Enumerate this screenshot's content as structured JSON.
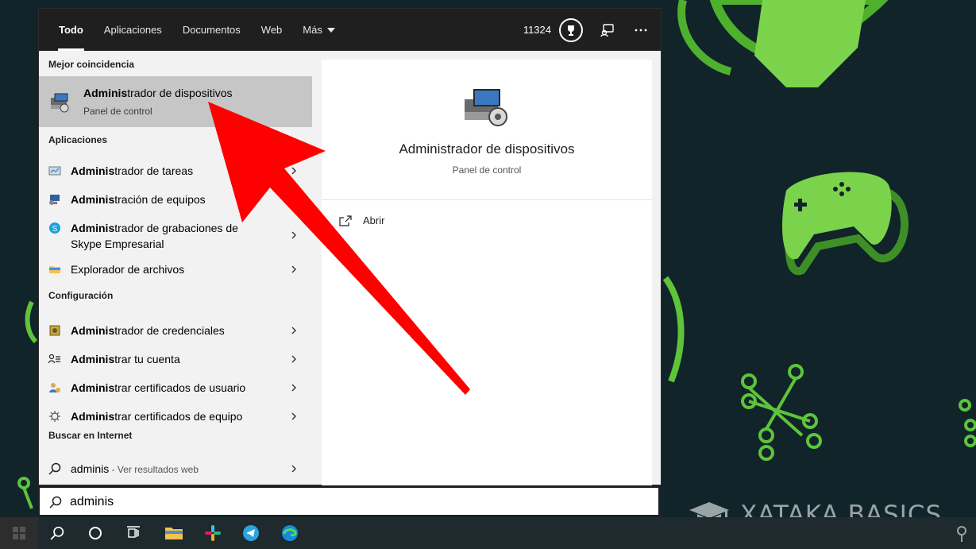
{
  "tabs": [
    {
      "label": "Todo",
      "active": true
    },
    {
      "label": "Aplicaciones"
    },
    {
      "label": "Documentos"
    },
    {
      "label": "Web"
    },
    {
      "label": "Más"
    }
  ],
  "topbar": {
    "points": "11324",
    "icons": [
      "trophy-icon",
      "feedback-icon",
      "more-options-icon"
    ]
  },
  "sections": {
    "best_match": "Mejor coincidencia",
    "apps": "Aplicaciones",
    "settings": "Configuración",
    "web": "Buscar en Internet"
  },
  "best_match": {
    "bold": "Adminis",
    "rest": "trador de dispositivos",
    "subtitle": "Panel de control"
  },
  "apps": [
    {
      "bold": "Adminis",
      "rest": "trador de tareas",
      "icon": "task-manager-icon"
    },
    {
      "bold": "Adminis",
      "rest": "tración de equipos",
      "icon": "computer-management-icon"
    },
    {
      "bold": "Adminis",
      "rest": "trador de grabaciones de",
      "rest2": "Skype Empresarial",
      "icon": "skype-icon"
    },
    {
      "bold": "",
      "rest": "Explorador de archivos",
      "icon": "folder-icon"
    }
  ],
  "settings": [
    {
      "bold": "Adminis",
      "rest": "trador de credenciales",
      "icon": "credential-manager-icon"
    },
    {
      "bold": "Adminis",
      "rest": "trar tu cuenta",
      "icon": "account-icon"
    },
    {
      "bold": "Adminis",
      "rest": "trar certificados de usuario",
      "icon": "user-certificates-icon"
    },
    {
      "bold": "Adminis",
      "rest": "trar certificados de equipo",
      "icon": "computer-certificates-icon"
    }
  ],
  "web": {
    "query": "adminis",
    "suffix": " - Ver resultados web"
  },
  "preview": {
    "title": "Administrador de dispositivos",
    "subtitle": "Panel de control",
    "action_open": "Abrir"
  },
  "search": {
    "value": "adminis"
  },
  "taskbar": {
    "icons": [
      "windows-start-icon",
      "search-icon",
      "cortana-icon",
      "task-view-icon",
      "file-explorer-icon",
      "slack-icon",
      "telegram-icon",
      "edge-icon"
    ]
  },
  "watermark": "XATAKA BASICS",
  "colors": {
    "accent_green": "#5ec43a",
    "annotation_red": "#ff0000",
    "wallpaper": "#11242a"
  }
}
